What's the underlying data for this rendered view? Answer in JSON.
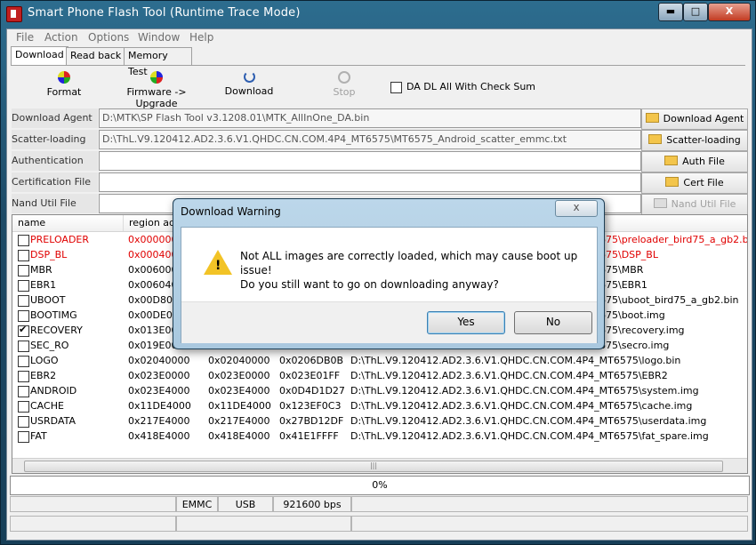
{
  "window": {
    "title": "Smart Phone Flash Tool (Runtime Trace Mode)",
    "min": "▬",
    "max": "□",
    "close": "X"
  },
  "menu": [
    "File",
    "Action",
    "Options",
    "Window",
    "Help"
  ],
  "tabs": [
    "Download",
    "Read back",
    "Memory Test"
  ],
  "toolbar": {
    "format": "Format",
    "firmware_upgrade": "Firmware -> Upgrade",
    "download": "Download",
    "stop": "Stop",
    "checksum_label": "DA DL All With Check Sum",
    "checksum_checked": false
  },
  "fields": {
    "download_agent": {
      "label": "Download Agent",
      "value": "D:\\MTK\\SP Flash Tool v3.1208.01\\MTK_AllInOne_DA.bin",
      "button": "Download Agent"
    },
    "scatter": {
      "label": "Scatter-loading File",
      "value": "D:\\ThL.V9.120412.AD2.3.6.V1.QHDC.CN.COM.4P4_MT6575\\MT6575_Android_scatter_emmc.txt",
      "button": "Scatter-loading"
    },
    "auth": {
      "label": "Authentication File",
      "value": "",
      "button": "Auth File"
    },
    "cert": {
      "label": "Certification File",
      "value": "",
      "button": "Cert File"
    },
    "nand": {
      "label": "Nand Util File",
      "value": "",
      "button": "Nand Util File"
    }
  },
  "table": {
    "headers": [
      "name",
      "region addr"
    ],
    "rows": [
      {
        "name": "PRELOADER",
        "begin": "0x0000000",
        "end": "",
        "size": "",
        "location": "675\\preloader_bird75_a_gb2.bin",
        "checked": false,
        "red": true
      },
      {
        "name": "DSP_BL",
        "begin": "0x0004000",
        "end": "",
        "size": "",
        "location": "675\\DSP_BL",
        "checked": false,
        "red": true
      },
      {
        "name": "MBR",
        "begin": "0x0060000",
        "end": "",
        "size": "",
        "location": "675\\MBR",
        "checked": false,
        "red": false
      },
      {
        "name": "EBR1",
        "begin": "0x0060400",
        "end": "",
        "size": "",
        "location": "675\\EBR1",
        "checked": false,
        "red": false
      },
      {
        "name": "UBOOT",
        "begin": "0x00D8000",
        "end": "",
        "size": "",
        "location": "675\\uboot_bird75_a_gb2.bin",
        "checked": false,
        "red": false
      },
      {
        "name": "BOOTIMG",
        "begin": "0x00DE000",
        "end": "",
        "size": "",
        "location": "675\\boot.img",
        "checked": false,
        "red": false
      },
      {
        "name": "RECOVERY",
        "begin": "0x013E000",
        "end": "",
        "size": "",
        "location": "675\\recovery.img",
        "checked": true,
        "red": false
      },
      {
        "name": "SEC_RO",
        "begin": "0x019E000",
        "end": "",
        "size": "",
        "location": "675\\secro.img",
        "checked": false,
        "red": false
      },
      {
        "name": "LOGO",
        "begin": "0x02040000",
        "end": "0x02040000",
        "size": "0x0206DB0B",
        "location": "D:\\ThL.V9.120412.AD2.3.6.V1.QHDC.CN.COM.4P4_MT6575\\logo.bin",
        "checked": false,
        "red": false
      },
      {
        "name": "EBR2",
        "begin": "0x023E0000",
        "end": "0x023E0000",
        "size": "0x023E01FF",
        "location": "D:\\ThL.V9.120412.AD2.3.6.V1.QHDC.CN.COM.4P4_MT6575\\EBR2",
        "checked": false,
        "red": false
      },
      {
        "name": "ANDROID",
        "begin": "0x023E4000",
        "end": "0x023E4000",
        "size": "0x0D4D1D27",
        "location": "D:\\ThL.V9.120412.AD2.3.6.V1.QHDC.CN.COM.4P4_MT6575\\system.img",
        "checked": false,
        "red": false
      },
      {
        "name": "CACHE",
        "begin": "0x11DE4000",
        "end": "0x11DE4000",
        "size": "0x123EF0C3",
        "location": "D:\\ThL.V9.120412.AD2.3.6.V1.QHDC.CN.COM.4P4_MT6575\\cache.img",
        "checked": false,
        "red": false
      },
      {
        "name": "USRDATA",
        "begin": "0x217E4000",
        "end": "0x217E4000",
        "size": "0x27BD12DF",
        "location": "D:\\ThL.V9.120412.AD2.3.6.V1.QHDC.CN.COM.4P4_MT6575\\userdata.img",
        "checked": false,
        "red": false
      },
      {
        "name": "FAT",
        "begin": "0x418E4000",
        "end": "0x418E4000",
        "size": "0x41E1FFFF",
        "location": "D:\\ThL.V9.120412.AD2.3.6.V1.QHDC.CN.COM.4P4_MT6575\\fat_spare.img",
        "checked": false,
        "red": false
      }
    ],
    "scroll_grip": "|||"
  },
  "progress": {
    "text": "0%",
    "fraction": 0
  },
  "status": {
    "storage": "EMMC",
    "port": "USB",
    "baud": "921600 bps"
  },
  "dialog": {
    "title": "Download Warning",
    "close": "x",
    "line1": "Not ALL images are correctly loaded, which may cause boot up issue!",
    "line2": "Do you still want to go on downloading anyway?",
    "yes": "Yes",
    "no": "No"
  },
  "colors": {
    "error_red": "#e00000",
    "warning_yellow": "#f2c326"
  }
}
